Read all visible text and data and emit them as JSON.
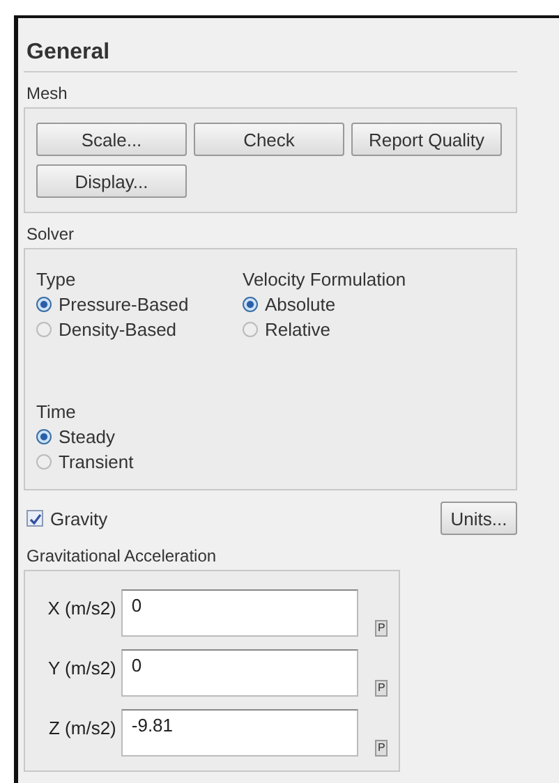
{
  "title": "General",
  "mesh": {
    "label": "Mesh",
    "buttons": [
      "Scale...",
      "Check",
      "Report Quality",
      "Display..."
    ]
  },
  "solver": {
    "label": "Solver",
    "groups": [
      {
        "label": "Type",
        "options": [
          {
            "label": "Pressure-Based",
            "selected": true
          },
          {
            "label": "Density-Based",
            "selected": false
          }
        ]
      },
      {
        "label": "Velocity Formulation",
        "options": [
          {
            "label": "Absolute",
            "selected": true
          },
          {
            "label": "Relative",
            "selected": false
          }
        ]
      },
      {
        "label": "Time",
        "options": [
          {
            "label": "Steady",
            "selected": true
          },
          {
            "label": "Transient",
            "selected": false
          }
        ]
      }
    ]
  },
  "gravity": {
    "label": "Gravity",
    "checked": true
  },
  "units_button": "Units...",
  "acceleration": {
    "label": "Gravitational Acceleration",
    "fields": [
      {
        "label": "X (m/s2)",
        "value": "0",
        "param": "P"
      },
      {
        "label": "Y (m/s2)",
        "value": "0",
        "param": "P"
      },
      {
        "label": "Z (m/s2)",
        "value": "-9.81",
        "param": "P"
      }
    ]
  }
}
